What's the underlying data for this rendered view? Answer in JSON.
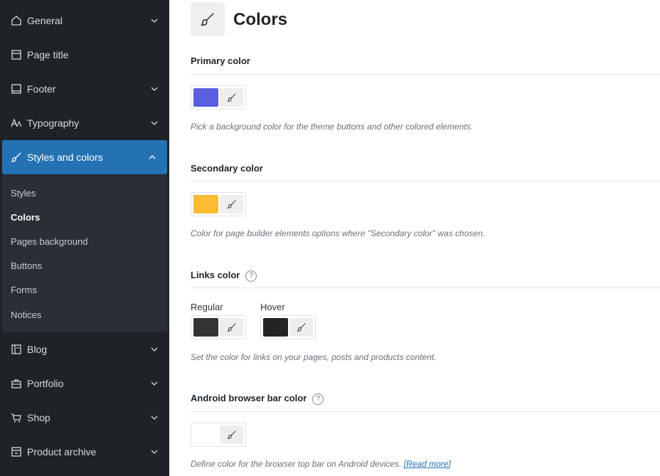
{
  "sidebar": {
    "items": [
      {
        "label": "General"
      },
      {
        "label": "Page title"
      },
      {
        "label": "Footer"
      },
      {
        "label": "Typography"
      },
      {
        "label": "Styles and colors"
      },
      {
        "label": "Blog"
      },
      {
        "label": "Portfolio"
      },
      {
        "label": "Shop"
      },
      {
        "label": "Product archive"
      }
    ],
    "submenu": [
      "Styles",
      "Colors",
      "Pages background",
      "Buttons",
      "Forms",
      "Notices"
    ]
  },
  "main": {
    "title": "Colors",
    "sections": {
      "primary": {
        "title": "Primary color",
        "color": "#5a5fe0",
        "desc": "Pick a background color for the theme buttons and other colored elements."
      },
      "secondary": {
        "title": "Secondary color",
        "color": "#fbbc34",
        "desc": "Color for page builder elements options where \"Secondary color\" was chosen."
      },
      "links": {
        "title": "Links color",
        "regular_label": "Regular",
        "hover_label": "Hover",
        "regular_color": "#333333",
        "hover_color": "#242424",
        "desc": "Set the color for links on your pages, posts and products content."
      },
      "android": {
        "title": "Android browser bar color",
        "desc": "Define color for the browser top bar on Android devices.",
        "link": "[Read more]"
      }
    },
    "help_glyph": "?"
  },
  "colors": {
    "sidebar_bg": "#1f2328",
    "active": "#2472b3"
  }
}
